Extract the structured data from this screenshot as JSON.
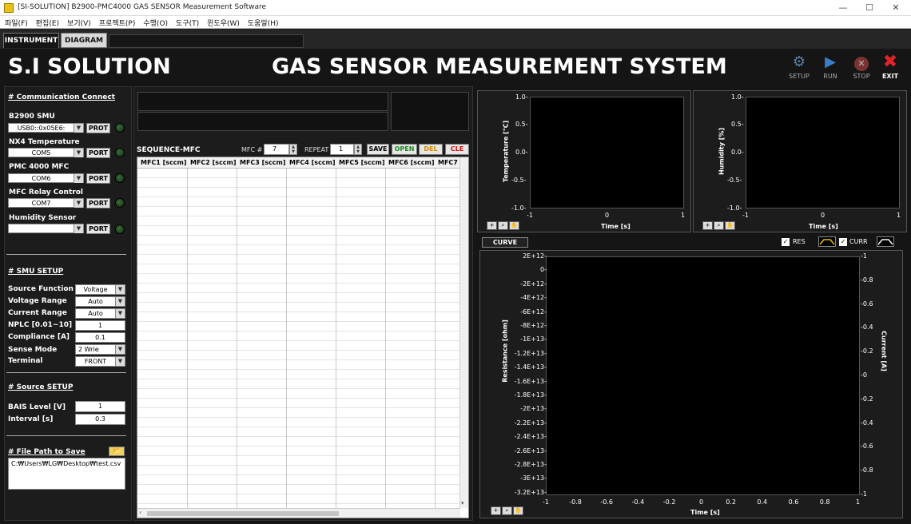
{
  "window": {
    "title": "[SI-SOLUTION] B2900-PMC4000 GAS SENSOR Measurement Software",
    "minimize": "—",
    "maximize": "☐",
    "close": "✕"
  },
  "menu": [
    "파일(F)",
    "편집(E)",
    "보기(V)",
    "프로젝트(P)",
    "수행(O)",
    "도구(T)",
    "윈도우(W)",
    "도움말(H)"
  ],
  "tabs": {
    "instrument": "INSTRUMENT",
    "diagram": "DIAGRAM"
  },
  "header": {
    "brand": "S.I SOLUTION",
    "title": "GAS SENSOR MEASUREMENT SYSTEM"
  },
  "toolbar": {
    "setup": "SETUP",
    "run": "RUN",
    "stop": "STOP",
    "exit": "EXIT"
  },
  "comm": {
    "heading": "# Communication Connect",
    "b2900": {
      "label": "B2900 SMU",
      "value": "USB0::0x05E6:",
      "btn": "PROT"
    },
    "nx4": {
      "label": "NX4 Temperature",
      "value": "COM5",
      "btn": "PORT"
    },
    "pmc": {
      "label": "PMC 4000 MFC",
      "value": "COM6",
      "btn": "PORT"
    },
    "relay": {
      "label": "MFC Relay Control",
      "value": "COM7",
      "btn": "PORT"
    },
    "humidity": {
      "label": "Humidity Sensor",
      "value": "",
      "btn": "PORT"
    }
  },
  "smu": {
    "heading": "# SMU SETUP",
    "source_function": {
      "label": "Source Function",
      "value": "Voltage"
    },
    "voltage_range": {
      "label": "Voltage Range",
      "value": "Auto"
    },
    "current_range": {
      "label": "Current Range",
      "value": "Auto"
    },
    "nplc": {
      "label": "NPLC  [0.01~10]",
      "value": "1"
    },
    "compliance": {
      "label": "Compliance [A]",
      "value": "0.1"
    },
    "sense_mode": {
      "label": "Sense Mode",
      "value": "2 Wrie"
    },
    "terminal": {
      "label": "Terminal",
      "value": "FRONT"
    }
  },
  "source": {
    "heading": "# Source  SETUP",
    "bias": {
      "label": "BAIS Level [V]",
      "value": "1"
    },
    "interval": {
      "label": "Interval [s]",
      "value": "0.3"
    }
  },
  "file": {
    "heading": "# File Path to Save",
    "path": "C:₩Users₩LG₩Desktop₩test.csv"
  },
  "sequence": {
    "title": "SEQUENCE-MFC",
    "mfc_label": "MFC #",
    "mfc_value": "7",
    "repeat_label": "REPEAT",
    "repeat_value": "1",
    "save": "SAVE",
    "open": "OPEN",
    "del": "DEL",
    "cle": "CLE",
    "columns": [
      "MFC1 [sccm]",
      "MFC2 [sccm]",
      "MFC3 [sccm]",
      "MFC4 [sccm]",
      "MFC5 [sccm]",
      "MFC6 [sccm]",
      "MFC7"
    ]
  },
  "temp_chart": {
    "ylabel": "Temperature [℃]",
    "xlabel": "Time [s]",
    "yticks": [
      "1.0-",
      "0.5-",
      "0.0-",
      "-0.5-",
      "-1.0-"
    ],
    "xticks": [
      "-1",
      "0",
      "1"
    ]
  },
  "hum_chart": {
    "ylabel": "Humidity [%]",
    "xlabel": "Time [s]",
    "yticks": [
      "1.0-",
      "0.5-",
      "0.0-",
      "-0.5-",
      "-1.0-"
    ],
    "xticks": [
      "-1",
      "0",
      "1"
    ]
  },
  "curve": {
    "tab": "CURVE",
    "res_label": "RES",
    "curr_label": "CURR",
    "ylabel": "Resistance [ohm]",
    "y2label": "Current [A]",
    "xlabel": "Time [s]",
    "yticks": [
      "2E+12-",
      "0-",
      "-2E+12-",
      "-4E+12-",
      "-6E+12-",
      "-8E+12-",
      "-1E+13-",
      "-1.2E+13-",
      "-1.4E+13-",
      "-1.6E+13-",
      "-1.8E+13-",
      "-2E+13-",
      "-2.2E+13-",
      "-2.4E+13-",
      "-2.6E+13-",
      "-2.8E+13-",
      "-3E+13-",
      "-3.2E+13-"
    ],
    "y2ticks": [
      "-1",
      "-0.8",
      "-0.6",
      "-0.4",
      "-0.2",
      "-0",
      "-0.2",
      "-0.4",
      "-0.6",
      "-0.8",
      "-1"
    ],
    "xticks": [
      "-1",
      "-0.8",
      "-0.6",
      "-0.4",
      "-0.2",
      "0",
      "0.2",
      "0.4",
      "0.6",
      "0.8",
      "1"
    ]
  },
  "colors": {
    "bg": "#151515",
    "panel": "#1c1c1c",
    "plot": "#000000",
    "led": "#1f4a1f"
  }
}
